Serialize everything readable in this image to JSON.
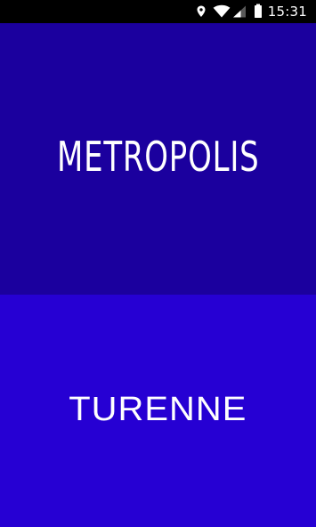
{
  "status_bar": {
    "time": "15:31",
    "icons": [
      "location-icon",
      "wifi-icon",
      "signal-icon",
      "battery-icon"
    ]
  },
  "fonts_list": {
    "items": [
      {
        "label": "METROPOLIS",
        "color": "#1b009e"
      },
      {
        "label": "TURENNE",
        "color": "#2600d3"
      }
    ]
  }
}
